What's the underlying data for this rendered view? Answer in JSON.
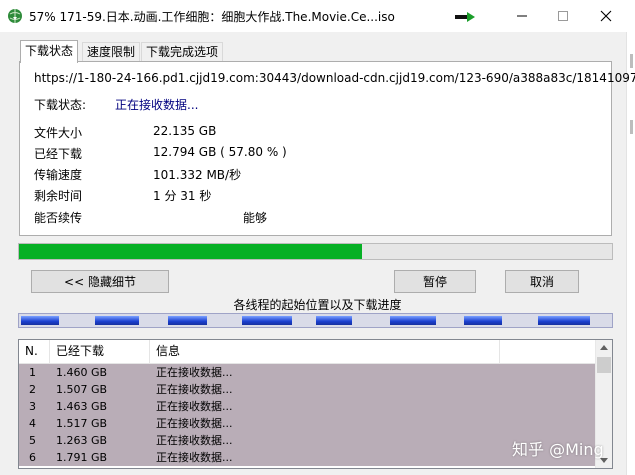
{
  "window": {
    "title": "57% 171-59.日本.动画.工作细胞：细胞大作战.The.Movie.Ce...iso",
    "icons": {
      "app": "globe-download-icon",
      "arrow": "green-arrow-icon",
      "minimize": "minimize-icon",
      "maximize": "maximize-icon",
      "close": "close-icon"
    }
  },
  "tabs": [
    {
      "label": "下载状态",
      "active": true
    },
    {
      "label": "速度限制",
      "active": false
    },
    {
      "label": "下载完成选项",
      "active": false
    }
  ],
  "status": {
    "url": "https://1-180-24-166.pd1.cjjd19.com:30443/download-cdn.cjjd19.com/123-690/a388a83c/18141097",
    "status_label": "下载状态:",
    "status_value": "正在接收数据...",
    "file_size_label": "文件大小",
    "file_size_value": "22.135  GB",
    "downloaded_label": "已经下载",
    "downloaded_value": "12.794  GB  ( 57.80 % )",
    "speed_label": "传输速度",
    "speed_value": "101.332  MB/秒",
    "remaining_label": "剩余时间",
    "remaining_value": "1 分 31 秒",
    "resume_label": "能否续传",
    "resume_value": "能够"
  },
  "progress": {
    "fraction": 0.578,
    "color": "#06b025"
  },
  "buttons": {
    "hide_details": "<< 隐藏细节",
    "pause": "暂停",
    "cancel": "取消"
  },
  "segments": {
    "title": "各线程的起始位置以及下载进度"
  },
  "threads": {
    "columns": [
      "N.",
      "已经下载",
      "信息"
    ],
    "rows": [
      {
        "n": "1",
        "downloaded": "1.460  GB",
        "info": "正在接收数据..."
      },
      {
        "n": "2",
        "downloaded": "1.507  GB",
        "info": "正在接收数据..."
      },
      {
        "n": "3",
        "downloaded": "1.463  GB",
        "info": "正在接收数据..."
      },
      {
        "n": "4",
        "downloaded": "1.517  GB",
        "info": "正在接收数据..."
      },
      {
        "n": "5",
        "downloaded": "1.263  GB",
        "info": "正在接收数据..."
      },
      {
        "n": "6",
        "downloaded": "1.791  GB",
        "info": "正在接收数据..."
      }
    ]
  },
  "watermark": "知乎 @Ming"
}
